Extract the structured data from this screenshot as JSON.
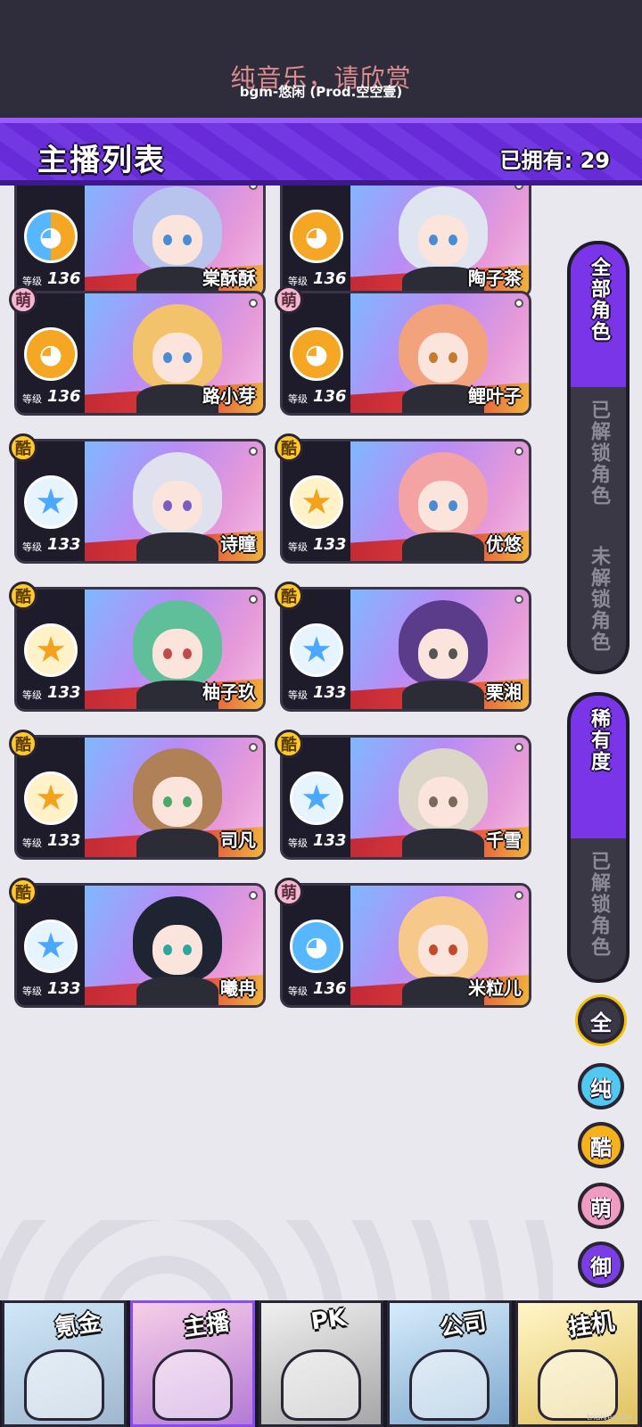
{
  "top": {
    "music_title": "纯音乐，请欣赏",
    "music_credit": "bgm-悠闲 (Prod.空空壹)"
  },
  "header": {
    "title": "主播列表",
    "owned": "已拥有: 29"
  },
  "level_label": "等级",
  "characters": [
    {
      "name": "棠酥酥",
      "level": "136",
      "type": "",
      "team_icon": "cat-split-icon"
    },
    {
      "name": "陶子茶",
      "level": "136",
      "type": "",
      "team_icon": "cat-orange-icon"
    },
    {
      "name": "路小芽",
      "level": "136",
      "type": "萌",
      "team_icon": "cat-orange-icon"
    },
    {
      "name": "鲤叶子",
      "level": "136",
      "type": "萌",
      "team_icon": "cat-orange-icon"
    },
    {
      "name": "诗瞳",
      "level": "133",
      "type": "酷",
      "team_icon": "star-blue-icon"
    },
    {
      "name": "优悠",
      "level": "133",
      "type": "酷",
      "team_icon": "star-gold-icon"
    },
    {
      "name": "柚子玖",
      "level": "133",
      "type": "酷",
      "team_icon": "star-gold-icon"
    },
    {
      "name": "栗湘",
      "level": "133",
      "type": "酷",
      "team_icon": "star-blue-icon"
    },
    {
      "name": "司凡",
      "level": "133",
      "type": "酷",
      "team_icon": "star-gold-icon"
    },
    {
      "name": "千雪",
      "level": "133",
      "type": "酷",
      "team_icon": "star-blue-icon"
    },
    {
      "name": "曦冉",
      "level": "133",
      "type": "酷",
      "team_icon": "star-blue-icon"
    },
    {
      "name": "米粒儿",
      "level": "136",
      "type": "萌",
      "team_icon": "cat-blue-icon"
    }
  ],
  "filter_panel_1": {
    "tabs": [
      "全部角色",
      "已解锁角色",
      "未解锁角色"
    ],
    "active": "全部角色"
  },
  "filter_panel_2": {
    "tabs": [
      "稀有度",
      "已解锁角色"
    ],
    "active": "稀有度"
  },
  "type_buttons": [
    "全",
    "纯",
    "酷",
    "萌",
    "御"
  ],
  "bottom_nav": [
    "氪金",
    "主播",
    "PK",
    "公司",
    "挂机"
  ],
  "watermark": "trialversion",
  "colors": {
    "accent_purple": "#6b2ee0",
    "top_bar": "#2f2c3c",
    "cool_yellow": "#ffc928",
    "cute_pink": "#f3b8cf",
    "pure_cyan": "#4fc9ef",
    "royal_purple": "#7b3ee6"
  }
}
